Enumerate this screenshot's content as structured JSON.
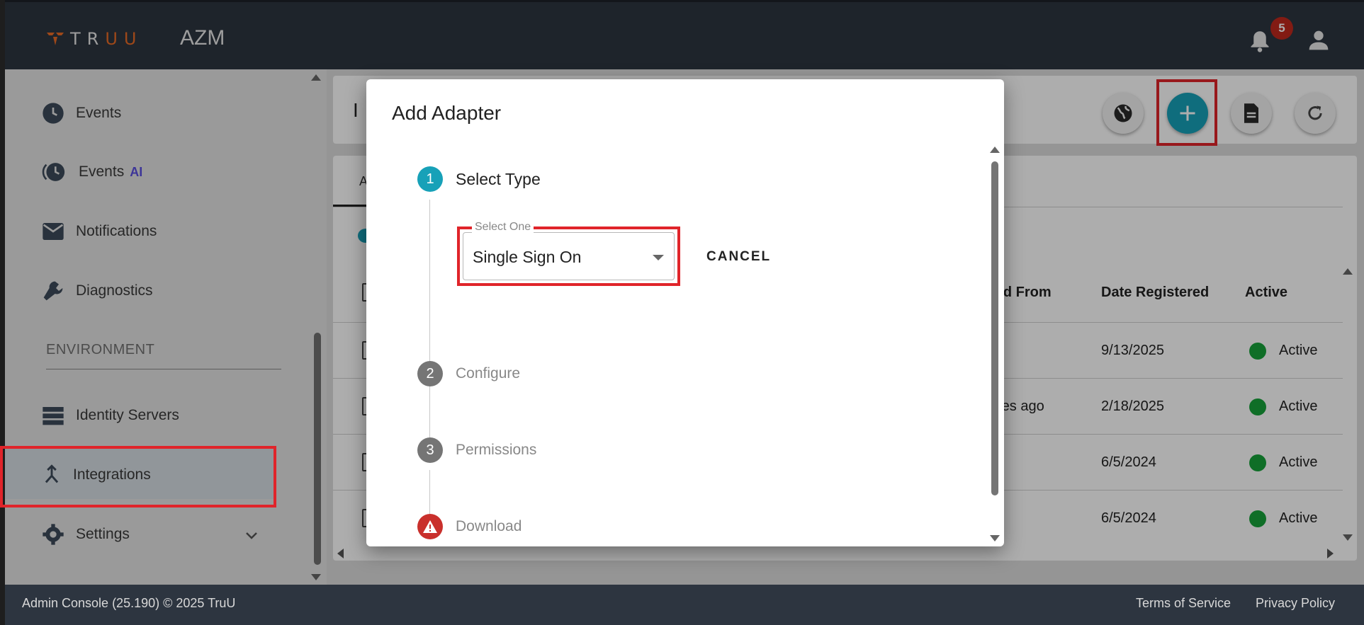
{
  "header": {
    "brand": "TRUU",
    "app_name": "AZM",
    "notification_count": "5"
  },
  "sidebar": {
    "items": [
      {
        "label": "Events",
        "icon": "clock-icon"
      },
      {
        "label": "Events",
        "tag": "AI",
        "icon": "clock-history-icon"
      },
      {
        "label": "Notifications",
        "icon": "mail-icon"
      },
      {
        "label": "Diagnostics",
        "icon": "wrench-icon"
      },
      {
        "label": "Identity Servers",
        "icon": "server-icon"
      },
      {
        "label": "Integrations",
        "icon": "merge-icon",
        "active": true
      },
      {
        "label": "Settings",
        "icon": "gear-icon"
      }
    ],
    "section_label": "ENVIRONMENT"
  },
  "content": {
    "title_partial": "I",
    "tab_partial": "A",
    "columns": [
      "ard From",
      "Date Registered",
      "Active"
    ],
    "rows": [
      {
        "from": "",
        "date": "9/13/2025",
        "status": "Active"
      },
      {
        "from": "utes ago",
        "date": "2/18/2025",
        "status": "Active"
      },
      {
        "from": "",
        "date": "6/5/2024",
        "status": "Active"
      },
      {
        "from": "",
        "date": "6/5/2024",
        "status": "Active"
      }
    ]
  },
  "modal": {
    "title": "Add Adapter",
    "steps": [
      {
        "num": "1",
        "label": "Select Type"
      },
      {
        "num": "2",
        "label": "Configure"
      },
      {
        "num": "3",
        "label": "Permissions"
      },
      {
        "num": "",
        "label": "Download"
      }
    ],
    "select": {
      "legend": "Select One",
      "value": "Single Sign On"
    },
    "cancel_label": "CANCEL"
  },
  "footer": {
    "left": "Admin Console (25.190) © 2025 TruU",
    "terms": "Terms of Service",
    "privacy": "Privacy Policy"
  },
  "colors": {
    "header_bg": "#2d3540",
    "accent": "#17a1b8",
    "brand_orange": "#e86a25",
    "highlight_red": "#e0242a",
    "status_green": "#17a23a"
  }
}
